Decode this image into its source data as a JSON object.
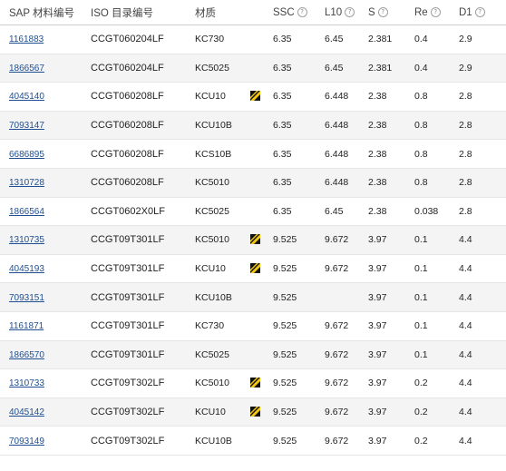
{
  "headers": {
    "sap": "SAP 材料编号",
    "iso": "ISO 目录编号",
    "grade": "材质",
    "ssc": "SSC",
    "l10": "L10",
    "s": "S",
    "re": "Re",
    "d1": "D1"
  },
  "icons": {
    "info": "info-icon",
    "grade_badge": "grade-coating-icon",
    "badge_colors": [
      "#f2c811",
      "#111111"
    ]
  },
  "rows": [
    {
      "sap": "1161883",
      "iso": "CCGT060204LF",
      "grade": "KC730",
      "badge": false,
      "ssc": "6.35",
      "l10": "6.45",
      "s": "2.381",
      "re": "0.4",
      "d1": "2.9"
    },
    {
      "sap": "1866567",
      "iso": "CCGT060204LF",
      "grade": "KC5025",
      "badge": false,
      "ssc": "6.35",
      "l10": "6.45",
      "s": "2.381",
      "re": "0.4",
      "d1": "2.9"
    },
    {
      "sap": "4045140",
      "iso": "CCGT060208LF",
      "grade": "KCU10",
      "badge": true,
      "ssc": "6.35",
      "l10": "6.448",
      "s": "2.38",
      "re": "0.8",
      "d1": "2.8"
    },
    {
      "sap": "7093147",
      "iso": "CCGT060208LF",
      "grade": "KCU10B",
      "badge": false,
      "ssc": "6.35",
      "l10": "6.448",
      "s": "2.38",
      "re": "0.8",
      "d1": "2.8"
    },
    {
      "sap": "6686895",
      "iso": "CCGT060208LF",
      "grade": "KCS10B",
      "badge": false,
      "ssc": "6.35",
      "l10": "6.448",
      "s": "2.38",
      "re": "0.8",
      "d1": "2.8"
    },
    {
      "sap": "1310728",
      "iso": "CCGT060208LF",
      "grade": "KC5010",
      "badge": false,
      "ssc": "6.35",
      "l10": "6.448",
      "s": "2.38",
      "re": "0.8",
      "d1": "2.8"
    },
    {
      "sap": "1866564",
      "iso": "CCGT0602X0LF",
      "grade": "KC5025",
      "badge": false,
      "ssc": "6.35",
      "l10": "6.45",
      "s": "2.38",
      "re": "0.038",
      "d1": "2.8"
    },
    {
      "sap": "1310735",
      "iso": "CCGT09T301LF",
      "grade": "KC5010",
      "badge": true,
      "ssc": "9.525",
      "l10": "9.672",
      "s": "3.97",
      "re": "0.1",
      "d1": "4.4"
    },
    {
      "sap": "4045193",
      "iso": "CCGT09T301LF",
      "grade": "KCU10",
      "badge": true,
      "ssc": "9.525",
      "l10": "9.672",
      "s": "3.97",
      "re": "0.1",
      "d1": "4.4"
    },
    {
      "sap": "7093151",
      "iso": "CCGT09T301LF",
      "grade": "KCU10B",
      "badge": false,
      "ssc": "9.525",
      "l10": "",
      "s": "3.97",
      "re": "0.1",
      "d1": "4.4"
    },
    {
      "sap": "1161871",
      "iso": "CCGT09T301LF",
      "grade": "KC730",
      "badge": false,
      "ssc": "9.525",
      "l10": "9.672",
      "s": "3.97",
      "re": "0.1",
      "d1": "4.4"
    },
    {
      "sap": "1866570",
      "iso": "CCGT09T301LF",
      "grade": "KC5025",
      "badge": false,
      "ssc": "9.525",
      "l10": "9.672",
      "s": "3.97",
      "re": "0.1",
      "d1": "4.4"
    },
    {
      "sap": "1310733",
      "iso": "CCGT09T302LF",
      "grade": "KC5010",
      "badge": true,
      "ssc": "9.525",
      "l10": "9.672",
      "s": "3.97",
      "re": "0.2",
      "d1": "4.4"
    },
    {
      "sap": "4045142",
      "iso": "CCGT09T302LF",
      "grade": "KCU10",
      "badge": true,
      "ssc": "9.525",
      "l10": "9.672",
      "s": "3.97",
      "re": "0.2",
      "d1": "4.4"
    },
    {
      "sap": "7093149",
      "iso": "CCGT09T302LF",
      "grade": "KCU10B",
      "badge": false,
      "ssc": "9.525",
      "l10": "9.672",
      "s": "3.97",
      "re": "0.2",
      "d1": "4.4"
    }
  ]
}
